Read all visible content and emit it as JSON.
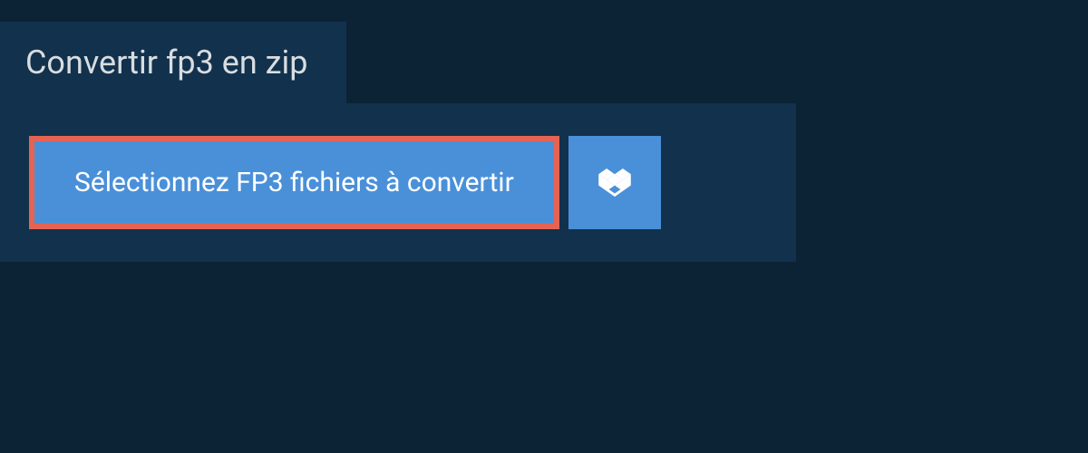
{
  "title": "Convertir fp3 en zip",
  "select_button_label": "Sélectionnez FP3 fichiers à convertir",
  "dropbox_icon_name": "dropbox-icon",
  "colors": {
    "background": "#0c2335",
    "panel": "#12314c",
    "button_bg": "#4a90d9",
    "button_border": "#e56353",
    "text_light": "#d8dde1",
    "text_white": "#ffffff"
  }
}
